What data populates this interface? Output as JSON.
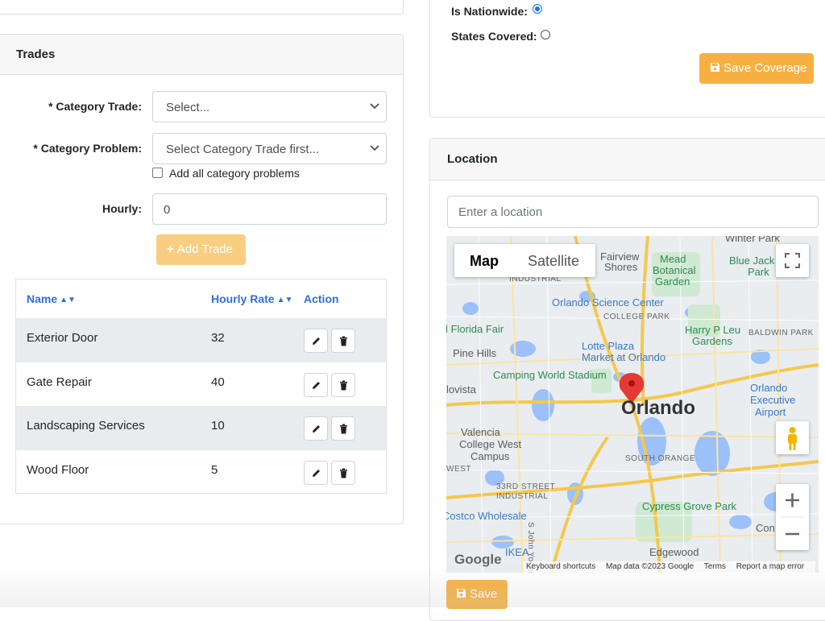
{
  "trades": {
    "title": "Trades",
    "category_trade_label": "* Category Trade:",
    "category_trade_value": "Select...",
    "category_problem_label": "* Category Problem:",
    "category_problem_value": "Select Category Trade first...",
    "add_all_label": "Add all category problems",
    "hourly_label": "Hourly:",
    "hourly_value": "0",
    "add_trade_label": "Add Trade",
    "table": {
      "headers": {
        "name": "Name",
        "rate": "Hourly Rate",
        "action": "Action"
      },
      "rows": [
        {
          "name": "Exterior Door",
          "rate": "32"
        },
        {
          "name": "Gate Repair",
          "rate": "40"
        },
        {
          "name": "Landscaping Services",
          "rate": "10"
        },
        {
          "name": "Wood Floor",
          "rate": "5"
        }
      ]
    }
  },
  "coverage": {
    "nationwide_label": "Is Nationwide:",
    "nationwide_selected": true,
    "states_label": "States Covered:",
    "save_label": "Save Coverage"
  },
  "location": {
    "title": "Location",
    "input_placeholder": "Enter a location",
    "save_label": "Save",
    "map": {
      "type_map": "Map",
      "type_satellite": "Satellite",
      "labels": {
        "winter_park": "Winter Park",
        "fairview": "Fairview",
        "shores": "Shores",
        "mead": "Mead",
        "botanical": "Botanical",
        "garden": "Garden",
        "blue_jack": "Blue Jack",
        "park": "Park",
        "industrial": "INDUSTRIAL",
        "science_center": "Orlando Science Center",
        "college_park": "COLLEGE PARK",
        "harry": "Harry P Leu",
        "gardens": "Gardens",
        "baldwin": "BALDWIN PARK",
        "fair": "Central Florida Fair",
        "pine_hills": "Pine Hills",
        "lotte": "Lotte Plaza",
        "lotte2": "Market at Orlando",
        "camping": "Camping World Stadium",
        "orlando": "Orlando",
        "exec1": "Orlando",
        "exec2": "Executive",
        "exec3": "Airport",
        "lovista": "lovista",
        "valencia": "Valencia",
        "vcwest": "College West",
        "campus": "Campus",
        "west": "WEST",
        "south_orange": "SOUTH ORANGE",
        "33rd": "33RD STREET",
        "industrial2": "INDUSTRIAL",
        "costco": "Costco Wholesale",
        "cypress": "Cypress Grove Park",
        "edgewood": "Edgewood",
        "ikea": "IKEA",
        "john_young": "S John Young Pkwy",
        "con": "Con",
        "google": "Google"
      },
      "footer": {
        "shortcuts": "Keyboard shortcuts",
        "data": "Map data ©2023 Google",
        "terms": "Terms",
        "report": "Report a map error"
      }
    }
  }
}
